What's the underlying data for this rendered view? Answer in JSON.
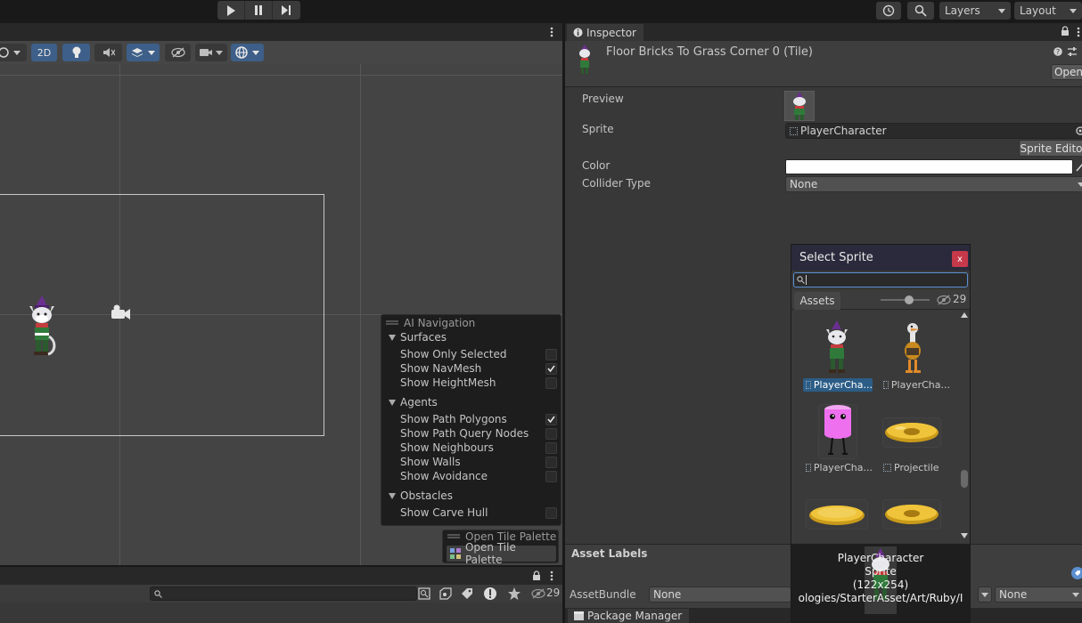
{
  "toolbar": {
    "layers_label": "Layers",
    "layout_label": "Layout"
  },
  "scene": {
    "mode_2d": "2D"
  },
  "ai_navigation": {
    "title": "AI Navigation",
    "sections": [
      {
        "label": "Surfaces",
        "items": [
          {
            "label": "Show Only Selected",
            "checked": false
          },
          {
            "label": "Show NavMesh",
            "checked": true
          },
          {
            "label": "Show HeightMesh",
            "checked": false
          }
        ]
      },
      {
        "label": "Agents",
        "items": [
          {
            "label": "Show Path Polygons",
            "checked": true
          },
          {
            "label": "Show Path Query Nodes",
            "checked": false
          },
          {
            "label": "Show Neighbours",
            "checked": false
          },
          {
            "label": "Show Walls",
            "checked": false
          },
          {
            "label": "Show Avoidance",
            "checked": false
          }
        ]
      },
      {
        "label": "Obstacles",
        "items": [
          {
            "label": "Show Carve Hull",
            "checked": false
          }
        ]
      }
    ]
  },
  "tile_palette": {
    "header": "Open Tile Palette",
    "button": "Open Tile Palette"
  },
  "console": {
    "hidden_count": "29"
  },
  "inspector": {
    "tab_label": "Inspector",
    "asset_title": "Floor Bricks To Grass Corner 0 (Tile)",
    "open_button": "Open",
    "preview_label": "Preview",
    "sprite_label": "Sprite",
    "sprite_value": "PlayerCharacter",
    "sprite_editor_button": "Sprite Editor",
    "color_label": "Color",
    "color_value": "#ffffff",
    "collider_label": "Collider Type",
    "collider_value": "None",
    "asset_labels_title": "Asset Labels",
    "asset_bundle_label": "AssetBundle",
    "asset_bundle_value": "None",
    "asset_bundle_variant": "None",
    "package_manager_tab": "Package Manager"
  },
  "select_sprite": {
    "title": "Select Sprite",
    "close_label": "x",
    "search_value": "",
    "tab_assets": "Assets",
    "hidden_count": "29",
    "items": [
      {
        "label": "PlayerCha...",
        "selected": true
      },
      {
        "label": "PlayerCha...",
        "selected": false
      },
      {
        "label": "PlayerCha...",
        "selected": false
      },
      {
        "label": "Projectile",
        "selected": false
      },
      {
        "label": "",
        "selected": false
      },
      {
        "label": "",
        "selected": false
      }
    ],
    "info": {
      "name": "PlayerCharacter",
      "type": "Sprite",
      "size": "(122x254)",
      "path": "ologies/StarterAsset/Art/Ruby/I"
    }
  }
}
